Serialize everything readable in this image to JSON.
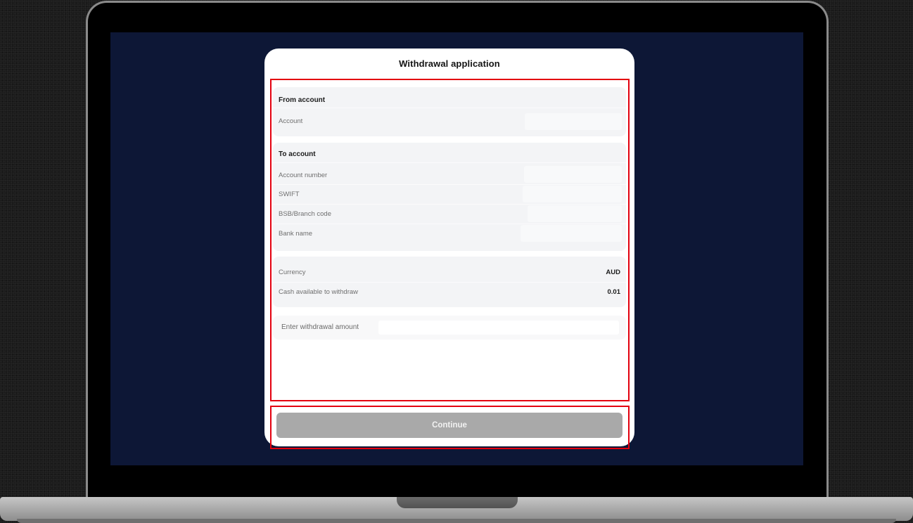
{
  "dialog": {
    "title": "Withdrawal application"
  },
  "from_account": {
    "heading": "From account",
    "rows": [
      {
        "label": "Account",
        "value": ""
      }
    ]
  },
  "to_account": {
    "heading": "To account",
    "rows": [
      {
        "label": "Account number",
        "value": ""
      },
      {
        "label": "SWIFT",
        "value": ""
      },
      {
        "label": "BSB/Branch code",
        "value": ""
      },
      {
        "label": "Bank name",
        "value": ""
      }
    ]
  },
  "summary": {
    "rows": [
      {
        "label": "Currency",
        "value": "AUD"
      },
      {
        "label": "Cash available to withdraw",
        "value": "0.01"
      }
    ]
  },
  "amount": {
    "placeholder": "Enter withdrawal amount",
    "value": ""
  },
  "actions": {
    "continue_label": "Continue"
  },
  "colors": {
    "screen_background": "#0d1736",
    "highlight_border": "#e3000f",
    "button_disabled": "#a9a9a9"
  }
}
